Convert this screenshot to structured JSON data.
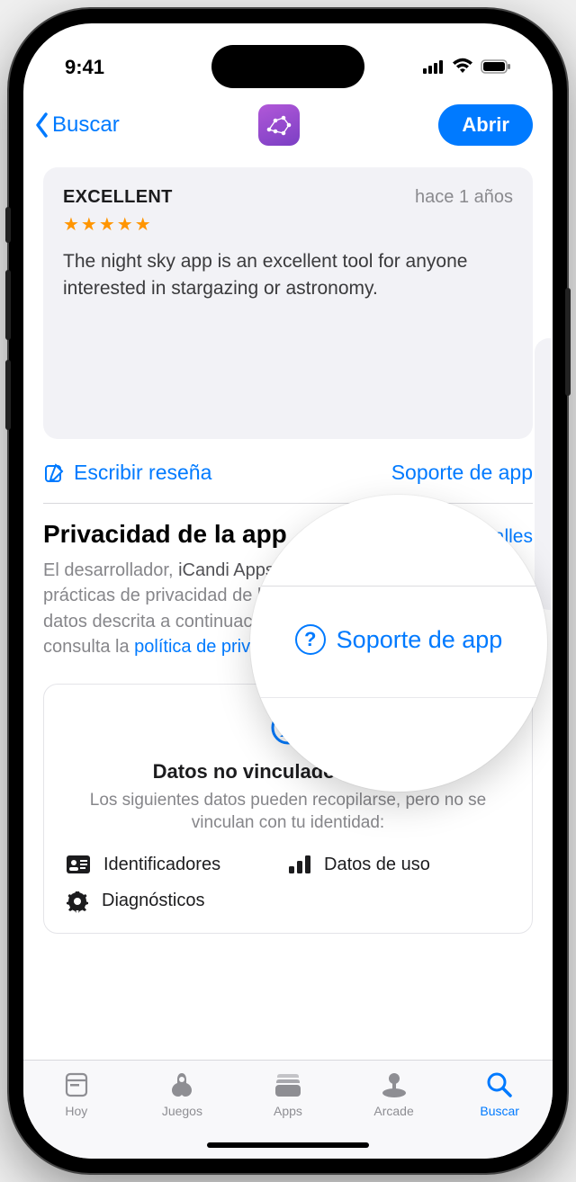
{
  "status": {
    "time": "9:41"
  },
  "nav": {
    "back": "Buscar",
    "open": "Abrir"
  },
  "review": {
    "title": "EXCELLENT",
    "age": "hace 1 años",
    "stars": "★★★★★",
    "body": "The night sky app is an excellent tool for anyone interested in stargazing or astronomy."
  },
  "actions": {
    "write": "Escribir reseña",
    "support": "Soporte de app"
  },
  "privacy": {
    "title": "Privacidad de la app",
    "details_link": "Ver detalles",
    "body_pre": "El desarrollador, ",
    "developer": "iCandi Apps Ltd.",
    "body_mid": ", ha indicado que las prácticas de privacidad de la app pueden incluir la gestión de datos descrita a continuación. Para obtener más información, consulta la ",
    "policy_link": "política de privacidad del desarrollador",
    "body_end": "."
  },
  "privacy_card": {
    "title": "Datos no vinculados contigo",
    "subtitle": "Los siguientes datos pueden recopilarse, pero no se vinculan con tu identidad:",
    "items": {
      "identifiers": "Identificadores",
      "usage": "Datos de uso",
      "diagnostics": "Diagnósticos"
    }
  },
  "tabs": {
    "today": "Hoy",
    "games": "Juegos",
    "apps": "Apps",
    "arcade": "Arcade",
    "search": "Buscar"
  },
  "magnifier": {
    "label": "Soporte de app"
  }
}
